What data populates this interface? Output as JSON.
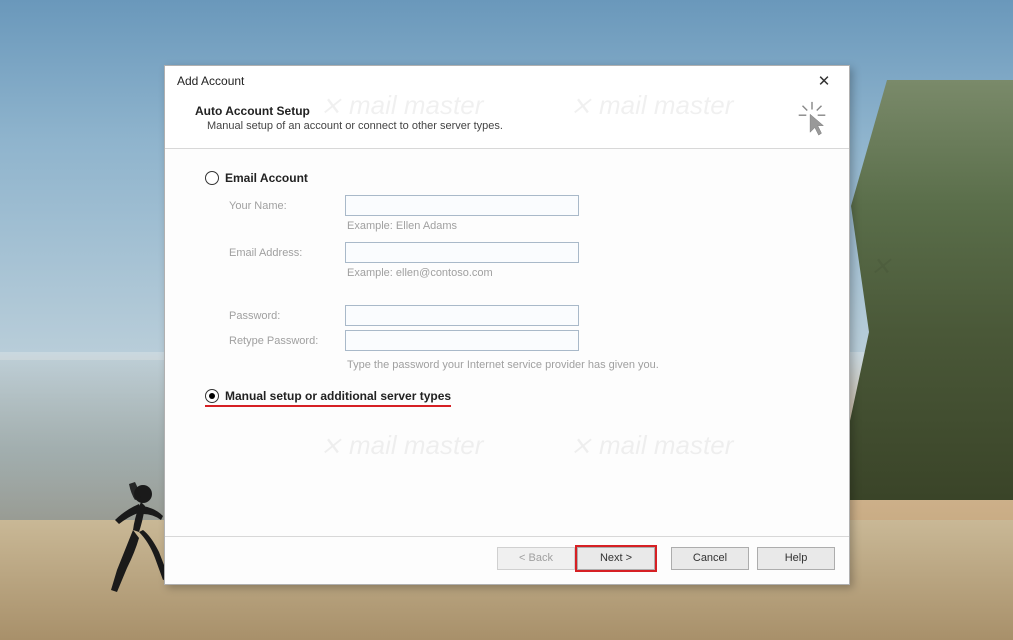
{
  "dialog": {
    "title": "Add Account",
    "header": {
      "title": "Auto Account Setup",
      "subtitle": "Manual setup of an account or connect to other server types."
    },
    "radio1": {
      "label": "Email Account",
      "selected": false
    },
    "fields": {
      "yourName": {
        "label": "Your Name:",
        "value": "",
        "example": "Example: Ellen Adams"
      },
      "email": {
        "label": "Email Address:",
        "value": "",
        "example": "Example: ellen@contoso.com"
      },
      "password": {
        "label": "Password:",
        "value": ""
      },
      "retype": {
        "label": "Retype Password:",
        "value": ""
      },
      "passwordHint": "Type the password your Internet service provider has given you."
    },
    "radio2": {
      "label": "Manual setup or additional server types",
      "selected": true
    },
    "buttons": {
      "back": "< Back",
      "next": "Next >",
      "cancel": "Cancel",
      "help": "Help"
    }
  }
}
